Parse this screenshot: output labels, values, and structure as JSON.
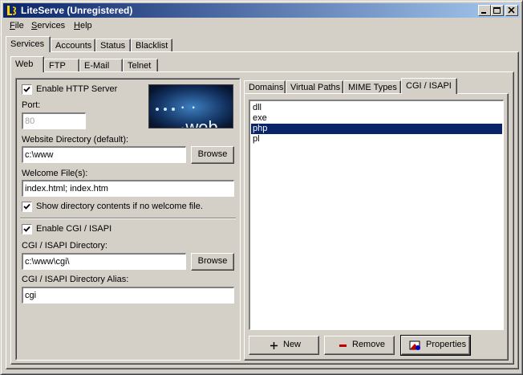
{
  "window": {
    "title": "LiteServe (Unregistered)"
  },
  "menu": {
    "file": "File",
    "services": "Services",
    "help": "Help"
  },
  "main_tabs": [
    "Services",
    "Accounts",
    "Status",
    "Blacklist"
  ],
  "service_tabs": [
    "Web",
    "FTP",
    "E-Mail",
    "Telnet"
  ],
  "web": {
    "enable_http_label": "Enable HTTP Server",
    "enable_http_checked": true,
    "port_label": "Port:",
    "port_value": "80",
    "banner_text": "· · ·web",
    "website_dir_label": "Website Directory (default):",
    "website_dir_value": "c:\\www",
    "browse_label": "Browse",
    "welcome_label": "Welcome File(s):",
    "welcome_value": "index.html; index.htm",
    "show_dir_label": "Show directory contents if no welcome file.",
    "show_dir_checked": true,
    "enable_cgi_label": "Enable CGI / ISAPI",
    "enable_cgi_checked": true,
    "cgi_dir_label": "CGI / ISAPI Directory:",
    "cgi_dir_value": "c:\\www\\cgi\\",
    "cgi_alias_label": "CGI / ISAPI Directory Alias:",
    "cgi_alias_value": "cgi"
  },
  "right_tabs": [
    "Domains",
    "Virtual Paths",
    "MIME Types",
    "CGI / ISAPI"
  ],
  "cgi_list": {
    "items": [
      "dll",
      "exe",
      "php",
      "pl"
    ],
    "selected": "php"
  },
  "buttons": {
    "new": "New",
    "remove": "Remove",
    "properties": "Properties"
  },
  "colors": {
    "title_active": "#0a246a",
    "selection": "#0a246a",
    "face": "#d4d0c8",
    "remove_icon": "#c00000",
    "new_icon": "#008000"
  }
}
